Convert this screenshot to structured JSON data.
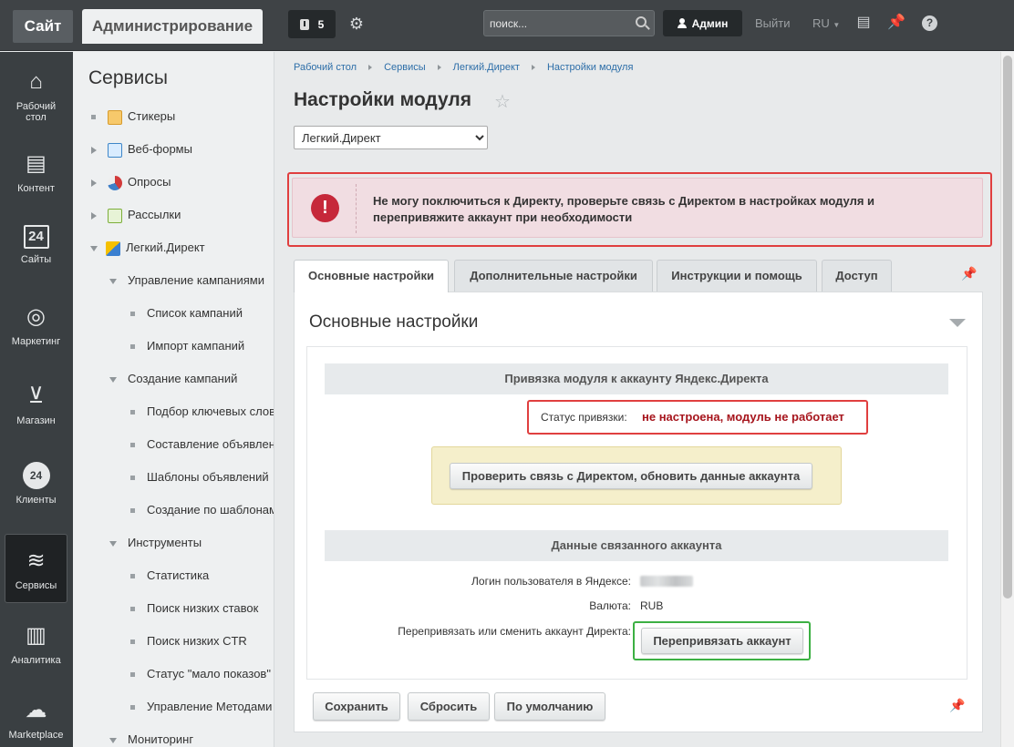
{
  "topbar": {
    "site_label": "Сайт",
    "admin_label": "Администрирование",
    "notifications_count": "5",
    "search_placeholder": "поиск...",
    "user_name": "Админ",
    "logout_label": "Выйти",
    "lang_label": "RU",
    "help_label": "?"
  },
  "iconbar": {
    "items": [
      {
        "label": "Рабочий стол",
        "icon": "home-icon"
      },
      {
        "label": "Контент",
        "icon": "document-icon"
      },
      {
        "label": "Сайты",
        "icon": "calendar-24-icon",
        "icon_text": "24"
      },
      {
        "label": "Маркетинг",
        "icon": "target-icon"
      },
      {
        "label": "Магазин",
        "icon": "basket-icon"
      },
      {
        "label": "Клиенты",
        "icon": "clients-24-icon",
        "icon_text": "24"
      },
      {
        "label": "Сервисы",
        "icon": "layers-icon",
        "active": true
      },
      {
        "label": "Аналитика",
        "icon": "bar-chart-icon"
      },
      {
        "label": "Marketplace",
        "icon": "cloud-download-icon"
      }
    ]
  },
  "services_menu": {
    "title": "Сервисы",
    "items": [
      {
        "label": "Стикеры"
      },
      {
        "label": "Веб-формы"
      },
      {
        "label": "Опросы"
      },
      {
        "label": "Рассылки"
      },
      {
        "label": "Легкий.Директ"
      },
      {
        "label": "Управление кампаниями"
      },
      {
        "label": "Список кампаний"
      },
      {
        "label": "Импорт кампаний"
      },
      {
        "label": "Создание кампаний"
      },
      {
        "label": "Подбор ключевых слов"
      },
      {
        "label": "Составление объявлений"
      },
      {
        "label": "Шаблоны объявлений"
      },
      {
        "label": "Создание по шаблонам"
      },
      {
        "label": "Инструменты"
      },
      {
        "label": "Статистика"
      },
      {
        "label": "Поиск низких ставок"
      },
      {
        "label": "Поиск низких CTR"
      },
      {
        "label": "Статус \"мало показов\""
      },
      {
        "label": "Управление Методами"
      },
      {
        "label": "Мониторинг"
      }
    ]
  },
  "breadcrumbs": [
    "Рабочий стол",
    "Сервисы",
    "Легкий.Директ",
    "Настройки модуля"
  ],
  "page_title": "Настройки модуля",
  "module_select": {
    "value": "Легкий.Директ",
    "options": [
      "Легкий.Директ"
    ]
  },
  "error_message": "Не могу поключиться к Директу, проверьте связь с Директом в настройках модуля и перепривяжите аккаунт при необходимости",
  "tabs": [
    {
      "label": "Основные настройки",
      "active": true
    },
    {
      "label": "Дополнительные настройки"
    },
    {
      "label": "Инструкции и помощь"
    },
    {
      "label": "Доступ"
    }
  ],
  "panel": {
    "title": "Основные настройки",
    "binding_header": "Привязка модуля к аккаунту Яндекс.Директа",
    "status_label": "Статус привязки:",
    "status_value": "не настроена, модуль не работает",
    "check_button": "Проверить связь с Директом, обновить данные аккаунта",
    "account_header": "Данные связанного аккаунта",
    "login_label": "Логин пользователя в Яндексе:",
    "currency_label": "Валюта:",
    "currency_value": "RUB",
    "rebind_label": "Перепривязать или сменить аккаунт Директа:",
    "rebind_button": "Перепривязать аккаунт"
  },
  "footer_buttons": {
    "save": "Сохранить",
    "reset": "Сбросить",
    "default": "По умолчанию"
  },
  "colors": {
    "error_border": "#e03f3f",
    "error_bg": "#f1dde2",
    "status_red": "#a6141c",
    "highlight_green": "#3cb043",
    "topbar_bg": "#3f4346"
  }
}
